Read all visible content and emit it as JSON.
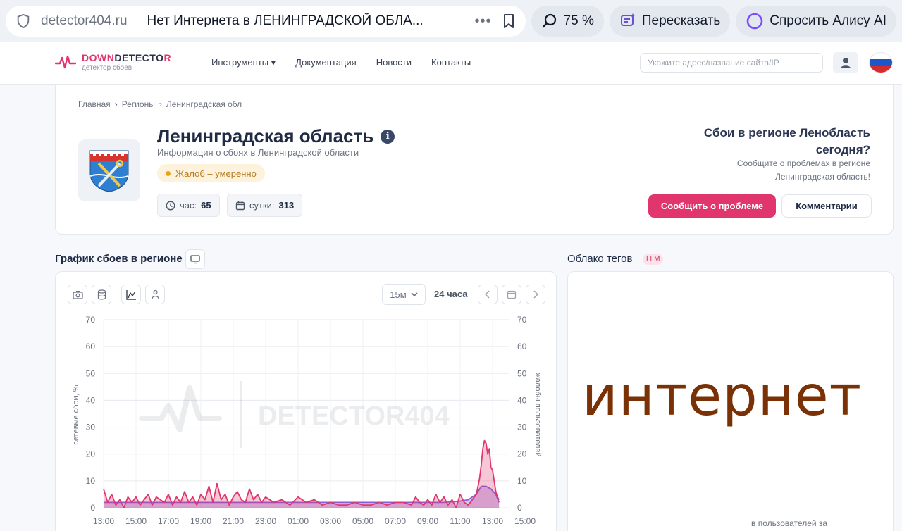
{
  "browser": {
    "domain": "detector404.ru",
    "tab_title": "Нет Интернета в ЛЕНИНГРАДСКОЙ ОБЛА...",
    "more": "•••",
    "zoom": "75 %",
    "retell": "Пересказать",
    "ask_alice": "Спросить Алису AI"
  },
  "header": {
    "logo_main_a": "DOWN",
    "logo_main_b": "DETECTO",
    "logo_main_c": "R",
    "logo_sub": "детектор сбоев",
    "nav": [
      "Инструменты ▾",
      "Документация",
      "Новости",
      "Контакты"
    ],
    "search_placeholder": "Укажите адрес/название сайта/IP"
  },
  "region": {
    "breadcrumb": [
      "Главная",
      "›",
      "Регионы",
      "›",
      "Ленинградская обл"
    ],
    "title": "Ленинградская область",
    "info": "i",
    "subtitle": "Информация о сбоях в Ленинградской области",
    "status": "Жалоб – умеренно",
    "hour_label": "час:",
    "hour_value": "65",
    "day_label": "сутки:",
    "day_value": "313",
    "right_title": "Сбои в регионе Ленобласть сегодня?",
    "right_sub": "Сообщите о проблемах в регионе Ленинградская область!",
    "report_button": "Сообщить о проблеме",
    "comments_button": "Комментарии"
  },
  "sections": {
    "chart_title": "График сбоев в регионе",
    "cloud_title": "Облако тегов",
    "llm": "LLM"
  },
  "chart_controls": {
    "interval": "15м",
    "range": "24 часа"
  },
  "cloud": {
    "word": "интернет",
    "caption": "в пользователей за"
  },
  "chart_data": {
    "type": "area",
    "ylabel": "сетевые сбои, %",
    "y2label": "жалобы пользователей",
    "watermark": "DETECTOR404",
    "ylim": [
      0,
      70
    ],
    "y_ticks": [
      0,
      10,
      20,
      30,
      40,
      50,
      60,
      70
    ],
    "x_ticks": [
      "13:00",
      "15:00",
      "17:00",
      "19:00",
      "21:00",
      "23:00",
      "01:00",
      "03:00",
      "05:00",
      "07:00",
      "09:00",
      "11:00",
      "13:00",
      "15:00"
    ],
    "x_start_hour": 13,
    "x_end_hour": 38,
    "series": [
      {
        "name": "complaints",
        "color": "#e0356d",
        "x": [
          13,
          13.25,
          13.5,
          13.75,
          14,
          14.25,
          14.5,
          14.75,
          15,
          15.25,
          15.5,
          15.75,
          16,
          16.25,
          16.5,
          16.75,
          17,
          17.25,
          17.5,
          17.75,
          18,
          18.25,
          18.5,
          18.75,
          19,
          19.25,
          19.5,
          19.75,
          20,
          20.25,
          20.5,
          20.75,
          21,
          21.25,
          21.5,
          21.75,
          22,
          22.25,
          22.5,
          22.75,
          23,
          23.5,
          24,
          24.5,
          25,
          25.5,
          26,
          26.5,
          27,
          27.5,
          28,
          28.5,
          29,
          29.5,
          30,
          30.5,
          31,
          31.5,
          32,
          32.25,
          32.5,
          32.75,
          33,
          33.25,
          33.5,
          33.75,
          34,
          34.25,
          34.5,
          34.75,
          35,
          35.25,
          35.5,
          35.75,
          36,
          36.1,
          36.2,
          36.3,
          36.4,
          36.5,
          36.6,
          36.7,
          36.8,
          36.9,
          37,
          37.1,
          37.2,
          37.3,
          37.4
        ],
        "y": [
          7,
          2,
          5,
          1,
          3,
          0,
          4,
          2,
          4,
          1,
          3,
          5,
          1,
          4,
          3,
          2,
          5,
          1,
          4,
          2,
          6,
          2,
          4,
          1,
          5,
          3,
          8,
          2,
          9,
          3,
          5,
          1,
          4,
          6,
          3,
          2,
          7,
          3,
          5,
          2,
          4,
          2,
          3,
          1,
          4,
          2,
          3,
          1,
          2,
          1,
          1,
          2,
          1,
          1,
          2,
          1,
          2,
          2,
          1,
          4,
          2,
          1,
          3,
          1,
          5,
          2,
          4,
          1,
          3,
          0,
          5,
          2,
          1,
          3,
          5,
          8,
          11,
          16,
          22,
          25,
          24,
          20,
          22,
          15,
          14,
          10,
          6,
          4,
          3
        ],
        "note": "complaints series, per 15 min"
      },
      {
        "name": "outages",
        "color": "#8a5cd6",
        "x": [
          13,
          14,
          15,
          16,
          17,
          18,
          19,
          20,
          21,
          22,
          23,
          24,
          25,
          26,
          27,
          28,
          29,
          30,
          31,
          32,
          33,
          34,
          35,
          35.5,
          36,
          36.3,
          36.6,
          36.9,
          37.2,
          37.4
        ],
        "y": [
          2,
          2,
          2,
          2,
          2,
          2,
          2,
          2,
          2,
          2,
          2,
          2,
          2,
          2,
          2,
          2,
          2,
          2,
          2,
          2,
          2,
          2,
          2.5,
          3,
          5,
          8,
          8,
          7,
          5,
          2
        ]
      }
    ]
  }
}
